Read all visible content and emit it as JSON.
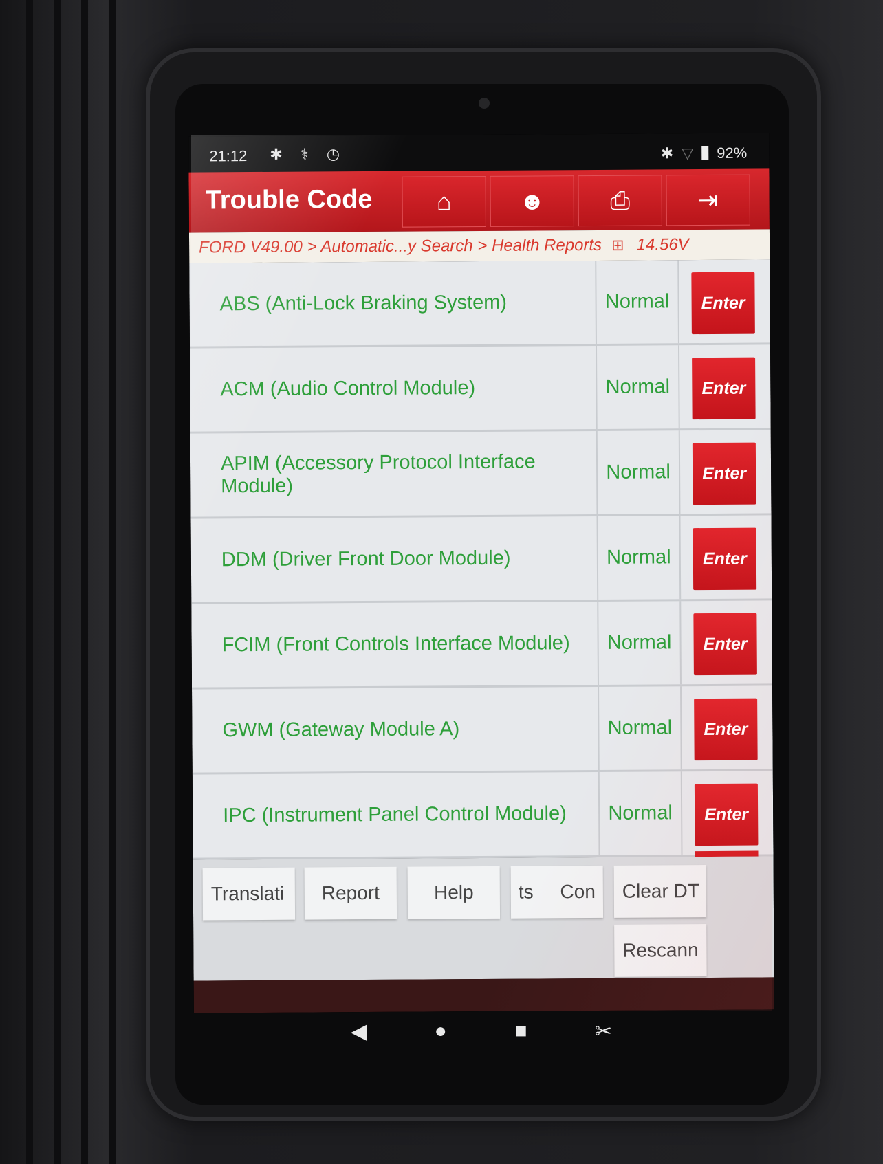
{
  "status_bar": {
    "time": "21:12",
    "icons_left": "✱ ⚕ ◷",
    "bluetooth": "✱",
    "wifi": "▽",
    "battery": "92%"
  },
  "header": {
    "title": "Trouble Code",
    "buttons": {
      "home": "⌂",
      "support": "☻",
      "print": "⎙",
      "exit": "⇥"
    }
  },
  "breadcrumb": {
    "path": "FORD V49.00 > Automatic...y Search > Health Reports",
    "icon": "⊞",
    "voltage": "14.56V"
  },
  "modules": [
    {
      "name": "ABS (Anti-Lock Braking System)",
      "status": "Normal",
      "action": "Enter"
    },
    {
      "name": "ACM (Audio Control Module)",
      "status": "Normal",
      "action": "Enter"
    },
    {
      "name": "APIM (Accessory Protocol Interface Module)",
      "status": "Normal",
      "action": "Enter"
    },
    {
      "name": "DDM (Driver Front Door Module)",
      "status": "Normal",
      "action": "Enter"
    },
    {
      "name": "FCIM (Front Controls Interface Module)",
      "status": "Normal",
      "action": "Enter"
    },
    {
      "name": "GWM (Gateway Module A)",
      "status": "Normal",
      "action": "Enter"
    },
    {
      "name": "IPC (Instrument Panel Control Module)",
      "status": "Normal",
      "action": "Enter"
    }
  ],
  "bottom_buttons": {
    "translation": "Translati",
    "report": "Report",
    "help": "Help",
    "components": "ts     Con",
    "clear_dtc": "Clear DT",
    "rescan": "Rescann"
  },
  "system_nav": {
    "back": "◀",
    "home": "●",
    "recents": "■",
    "screenshot": "✂"
  },
  "colors": {
    "brand_red": "#c81b21",
    "status_green": "#2e9f3a",
    "breadcrumb_red": "#d93a2e"
  }
}
